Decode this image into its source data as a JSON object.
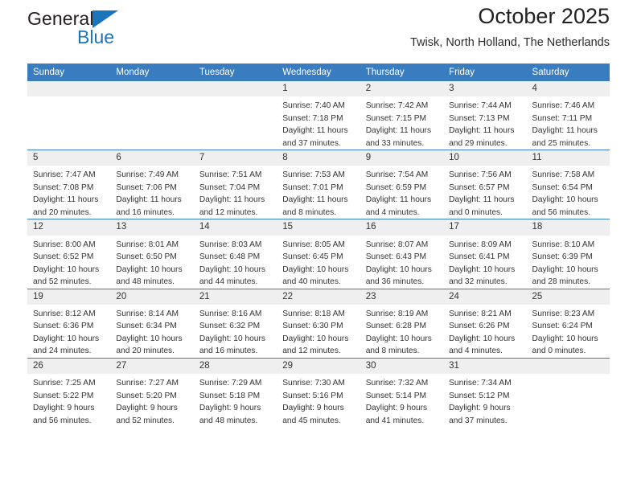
{
  "brand": {
    "name_dark": "General",
    "name_blue": "Blue",
    "triangle_color": "#1a75bb"
  },
  "header": {
    "title": "October 2025",
    "subtitle": "Twisk, North Holland, The Netherlands",
    "header_bg": "#3a7cc0",
    "daynum_bg": "#efefef"
  },
  "weekdays": [
    "Sunday",
    "Monday",
    "Tuesday",
    "Wednesday",
    "Thursday",
    "Friday",
    "Saturday"
  ],
  "weeks": [
    [
      {
        "day": "",
        "sunrise": "",
        "sunset": "",
        "daylight1": "",
        "daylight2": ""
      },
      {
        "day": "",
        "sunrise": "",
        "sunset": "",
        "daylight1": "",
        "daylight2": ""
      },
      {
        "day": "",
        "sunrise": "",
        "sunset": "",
        "daylight1": "",
        "daylight2": ""
      },
      {
        "day": "1",
        "sunrise": "Sunrise: 7:40 AM",
        "sunset": "Sunset: 7:18 PM",
        "daylight1": "Daylight: 11 hours",
        "daylight2": "and 37 minutes."
      },
      {
        "day": "2",
        "sunrise": "Sunrise: 7:42 AM",
        "sunset": "Sunset: 7:15 PM",
        "daylight1": "Daylight: 11 hours",
        "daylight2": "and 33 minutes."
      },
      {
        "day": "3",
        "sunrise": "Sunrise: 7:44 AM",
        "sunset": "Sunset: 7:13 PM",
        "daylight1": "Daylight: 11 hours",
        "daylight2": "and 29 minutes."
      },
      {
        "day": "4",
        "sunrise": "Sunrise: 7:46 AM",
        "sunset": "Sunset: 7:11 PM",
        "daylight1": "Daylight: 11 hours",
        "daylight2": "and 25 minutes."
      }
    ],
    [
      {
        "day": "5",
        "sunrise": "Sunrise: 7:47 AM",
        "sunset": "Sunset: 7:08 PM",
        "daylight1": "Daylight: 11 hours",
        "daylight2": "and 20 minutes."
      },
      {
        "day": "6",
        "sunrise": "Sunrise: 7:49 AM",
        "sunset": "Sunset: 7:06 PM",
        "daylight1": "Daylight: 11 hours",
        "daylight2": "and 16 minutes."
      },
      {
        "day": "7",
        "sunrise": "Sunrise: 7:51 AM",
        "sunset": "Sunset: 7:04 PM",
        "daylight1": "Daylight: 11 hours",
        "daylight2": "and 12 minutes."
      },
      {
        "day": "8",
        "sunrise": "Sunrise: 7:53 AM",
        "sunset": "Sunset: 7:01 PM",
        "daylight1": "Daylight: 11 hours",
        "daylight2": "and 8 minutes."
      },
      {
        "day": "9",
        "sunrise": "Sunrise: 7:54 AM",
        "sunset": "Sunset: 6:59 PM",
        "daylight1": "Daylight: 11 hours",
        "daylight2": "and 4 minutes."
      },
      {
        "day": "10",
        "sunrise": "Sunrise: 7:56 AM",
        "sunset": "Sunset: 6:57 PM",
        "daylight1": "Daylight: 11 hours",
        "daylight2": "and 0 minutes."
      },
      {
        "day": "11",
        "sunrise": "Sunrise: 7:58 AM",
        "sunset": "Sunset: 6:54 PM",
        "daylight1": "Daylight: 10 hours",
        "daylight2": "and 56 minutes."
      }
    ],
    [
      {
        "day": "12",
        "sunrise": "Sunrise: 8:00 AM",
        "sunset": "Sunset: 6:52 PM",
        "daylight1": "Daylight: 10 hours",
        "daylight2": "and 52 minutes."
      },
      {
        "day": "13",
        "sunrise": "Sunrise: 8:01 AM",
        "sunset": "Sunset: 6:50 PM",
        "daylight1": "Daylight: 10 hours",
        "daylight2": "and 48 minutes."
      },
      {
        "day": "14",
        "sunrise": "Sunrise: 8:03 AM",
        "sunset": "Sunset: 6:48 PM",
        "daylight1": "Daylight: 10 hours",
        "daylight2": "and 44 minutes."
      },
      {
        "day": "15",
        "sunrise": "Sunrise: 8:05 AM",
        "sunset": "Sunset: 6:45 PM",
        "daylight1": "Daylight: 10 hours",
        "daylight2": "and 40 minutes."
      },
      {
        "day": "16",
        "sunrise": "Sunrise: 8:07 AM",
        "sunset": "Sunset: 6:43 PM",
        "daylight1": "Daylight: 10 hours",
        "daylight2": "and 36 minutes."
      },
      {
        "day": "17",
        "sunrise": "Sunrise: 8:09 AM",
        "sunset": "Sunset: 6:41 PM",
        "daylight1": "Daylight: 10 hours",
        "daylight2": "and 32 minutes."
      },
      {
        "day": "18",
        "sunrise": "Sunrise: 8:10 AM",
        "sunset": "Sunset: 6:39 PM",
        "daylight1": "Daylight: 10 hours",
        "daylight2": "and 28 minutes."
      }
    ],
    [
      {
        "day": "19",
        "sunrise": "Sunrise: 8:12 AM",
        "sunset": "Sunset: 6:36 PM",
        "daylight1": "Daylight: 10 hours",
        "daylight2": "and 24 minutes."
      },
      {
        "day": "20",
        "sunrise": "Sunrise: 8:14 AM",
        "sunset": "Sunset: 6:34 PM",
        "daylight1": "Daylight: 10 hours",
        "daylight2": "and 20 minutes."
      },
      {
        "day": "21",
        "sunrise": "Sunrise: 8:16 AM",
        "sunset": "Sunset: 6:32 PM",
        "daylight1": "Daylight: 10 hours",
        "daylight2": "and 16 minutes."
      },
      {
        "day": "22",
        "sunrise": "Sunrise: 8:18 AM",
        "sunset": "Sunset: 6:30 PM",
        "daylight1": "Daylight: 10 hours",
        "daylight2": "and 12 minutes."
      },
      {
        "day": "23",
        "sunrise": "Sunrise: 8:19 AM",
        "sunset": "Sunset: 6:28 PM",
        "daylight1": "Daylight: 10 hours",
        "daylight2": "and 8 minutes."
      },
      {
        "day": "24",
        "sunrise": "Sunrise: 8:21 AM",
        "sunset": "Sunset: 6:26 PM",
        "daylight1": "Daylight: 10 hours",
        "daylight2": "and 4 minutes."
      },
      {
        "day": "25",
        "sunrise": "Sunrise: 8:23 AM",
        "sunset": "Sunset: 6:24 PM",
        "daylight1": "Daylight: 10 hours",
        "daylight2": "and 0 minutes."
      }
    ],
    [
      {
        "day": "26",
        "sunrise": "Sunrise: 7:25 AM",
        "sunset": "Sunset: 5:22 PM",
        "daylight1": "Daylight: 9 hours",
        "daylight2": "and 56 minutes."
      },
      {
        "day": "27",
        "sunrise": "Sunrise: 7:27 AM",
        "sunset": "Sunset: 5:20 PM",
        "daylight1": "Daylight: 9 hours",
        "daylight2": "and 52 minutes."
      },
      {
        "day": "28",
        "sunrise": "Sunrise: 7:29 AM",
        "sunset": "Sunset: 5:18 PM",
        "daylight1": "Daylight: 9 hours",
        "daylight2": "and 48 minutes."
      },
      {
        "day": "29",
        "sunrise": "Sunrise: 7:30 AM",
        "sunset": "Sunset: 5:16 PM",
        "daylight1": "Daylight: 9 hours",
        "daylight2": "and 45 minutes."
      },
      {
        "day": "30",
        "sunrise": "Sunrise: 7:32 AM",
        "sunset": "Sunset: 5:14 PM",
        "daylight1": "Daylight: 9 hours",
        "daylight2": "and 41 minutes."
      },
      {
        "day": "31",
        "sunrise": "Sunrise: 7:34 AM",
        "sunset": "Sunset: 5:12 PM",
        "daylight1": "Daylight: 9 hours",
        "daylight2": "and 37 minutes."
      },
      {
        "day": "",
        "sunrise": "",
        "sunset": "",
        "daylight1": "",
        "daylight2": ""
      }
    ]
  ]
}
